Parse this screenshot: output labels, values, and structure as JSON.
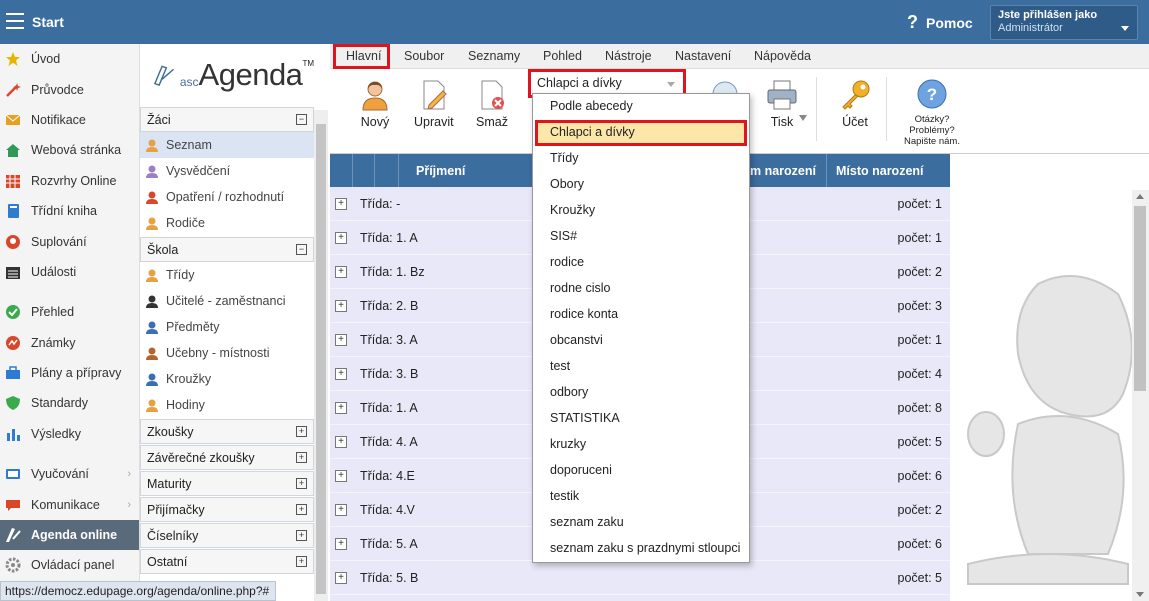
{
  "header": {
    "start_label": "Start",
    "help_label": "Pomoc",
    "user_label": "Jste přihlášen jako",
    "user_name": "Administrátor"
  },
  "leftnav": [
    {
      "label": "Úvod",
      "icon": "star-icon",
      "color": "#e8b400"
    },
    {
      "label": "Průvodce",
      "icon": "wand-icon",
      "color": "#d9472b"
    },
    {
      "label": "Notifikace",
      "icon": "envelope-icon",
      "color": "#e8a020"
    },
    {
      "label": "Webová stránka",
      "icon": "home-icon",
      "color": "#2e9a58"
    },
    {
      "label": "Rozvrhy Online",
      "icon": "timetable-icon",
      "color": "#d9472b"
    },
    {
      "label": "Třídní kniha",
      "icon": "book-icon",
      "color": "#2e7bd1"
    },
    {
      "label": "Suplování",
      "icon": "substitution-icon",
      "color": "#d9472b"
    },
    {
      "label": "Události",
      "icon": "calendar-icon",
      "color": "#333333"
    },
    {
      "label": "Přehled",
      "icon": "check-circle-icon",
      "color": "#3aaa4f"
    },
    {
      "label": "Známky",
      "icon": "grades-icon",
      "color": "#d9472b"
    },
    {
      "label": "Plány a přípravy",
      "icon": "briefcase-icon",
      "color": "#2e7bd1"
    },
    {
      "label": "Standardy",
      "icon": "shield-icon",
      "color": "#3aaa4f"
    },
    {
      "label": "Výsledky",
      "icon": "bar-chart-icon",
      "color": "#2e7bd1"
    },
    {
      "label": "Vyučování",
      "icon": "teaching-icon",
      "color": "#2e7bd1"
    },
    {
      "label": "Komunikace",
      "icon": "chat-icon",
      "color": "#d9472b"
    },
    {
      "label": "Agenda online",
      "icon": "agenda-icon",
      "color": "#ffffff"
    },
    {
      "label": "Ovládací panel",
      "icon": "gear-icon",
      "color": "#888888"
    }
  ],
  "agenda": {
    "logo_prefix": "asc",
    "logo_main": "Agenda",
    "logo_tm": "TM",
    "sections": [
      {
        "title": "Žáci",
        "toggle": "−",
        "items": [
          {
            "label": "Seznam",
            "icon": "student-icon"
          },
          {
            "label": "Vysvědčení",
            "icon": "certificate-icon"
          },
          {
            "label": "Opatření / rozhodnutí",
            "icon": "pin-icon"
          },
          {
            "label": "Rodiče",
            "icon": "parents-icon"
          }
        ]
      },
      {
        "title": "Škola",
        "toggle": "−",
        "items": [
          {
            "label": "Třídy",
            "icon": "class-icon"
          },
          {
            "label": "Učitelé - zaměstnanci",
            "icon": "teacher-icon"
          },
          {
            "label": "Předměty",
            "icon": "subject-icon"
          },
          {
            "label": "Učebny - místnosti",
            "icon": "room-icon"
          },
          {
            "label": "Kroužky",
            "icon": "club-icon"
          },
          {
            "label": "Hodiny",
            "icon": "hours-icon"
          }
        ]
      }
    ],
    "collapsed": [
      "Zkoušky",
      "Závěrečné zkoušky",
      "Maturity",
      "Přijímačky",
      "Číselníky",
      "Ostatní"
    ]
  },
  "menubar": [
    "Hlavní",
    "Soubor",
    "Seznamy",
    "Pohled",
    "Nástroje",
    "Nastavení",
    "Nápověda"
  ],
  "toolbar": {
    "new": "Nový",
    "edit": "Upravit",
    "delete": "Smaž",
    "print": "Tisk",
    "account": "Účet",
    "help_l1": "Otázky?",
    "help_l2": "Problémy?",
    "help_l3": "Napište nám."
  },
  "dropdown": {
    "value": "Chlapci a dívky",
    "options": [
      "Podle abecedy",
      "Chlapci a dívky",
      "Třídy",
      "Obory",
      "Kroužky",
      "SIS#",
      "rodice",
      "rodne cislo",
      "rodice konta",
      "obcanstvi",
      "test",
      "odbory",
      "STATISTIKA",
      "kruzky",
      "doporuceni",
      "testik",
      "seznam zaku",
      "seznam zaku s prazdnymi stloupci"
    ]
  },
  "grid": {
    "col_surname": "Příjmení",
    "col_birthdate": "m narození",
    "col_birthplace": "Místo narození",
    "rows": [
      {
        "label": "Třída: -",
        "count": "počet: 1"
      },
      {
        "label": "Třída: 1. A",
        "count": "počet: 1"
      },
      {
        "label": "Třída: 1. Bz",
        "count": "počet: 2"
      },
      {
        "label": "Třída: 2. B",
        "count": "počet: 3"
      },
      {
        "label": "Třída: 3. A",
        "count": "počet: 1"
      },
      {
        "label": "Třída: 3. B",
        "count": "počet: 4"
      },
      {
        "label": "Třída: 1. A",
        "count": "počet: 8"
      },
      {
        "label": "Třída: 4. A",
        "count": "počet: 5"
      },
      {
        "label": "Třída: 4.E",
        "count": "počet: 6"
      },
      {
        "label": "Třída: 4.V",
        "count": "počet: 2"
      },
      {
        "label": "Třída: 5. A",
        "count": "počet: 6"
      },
      {
        "label": "Třída: 5. B",
        "count": "počet: 5"
      }
    ]
  },
  "status": {
    "url": "https://democz.edupage.org/agenda/online.php?#"
  }
}
